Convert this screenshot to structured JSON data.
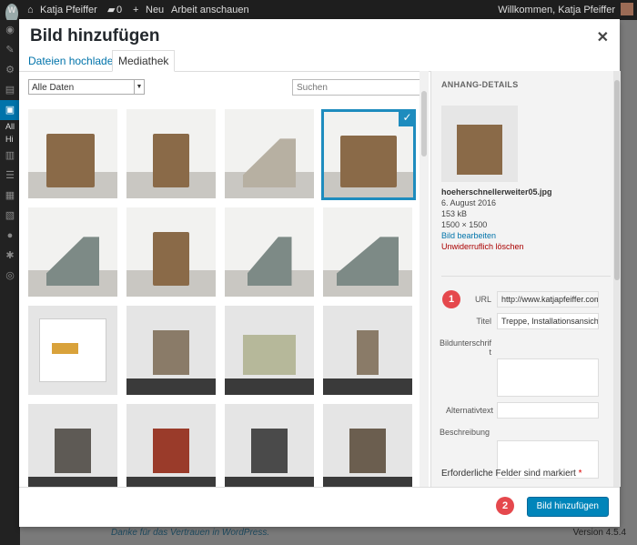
{
  "adminbar": {
    "site_name": "Katja Pfeiffer",
    "comments_count": "0",
    "new_label": "Neu",
    "view_label": "Arbeit anschauen",
    "greeting": "Willkommen, Katja Pfeiffer"
  },
  "sidebar": {
    "labels": [
      "All",
      "Hi"
    ]
  },
  "footer": {
    "thanks": "Danke für das Vertrauen in WordPress.",
    "version": "Version 4.5.4"
  },
  "modal": {
    "title": "Bild hinzufügen",
    "tabs": [
      {
        "label": "Dateien hochladen"
      },
      {
        "label": "Mediathek"
      }
    ],
    "filter_value": "Alle Daten",
    "search_placeholder": "Suchen",
    "details": {
      "heading": "ANHANG-DETAILS",
      "filename": "hoeherschnellerweiter05.jpg",
      "date": "6. August 2016",
      "size": "153 kB",
      "dimensions": "1500 × 1500",
      "edit_link": "Bild bearbeiten",
      "delete_link": "Unwiderruflich löschen",
      "url_label": "URL",
      "url_value": "http://www.katjapfeiffer.com",
      "title_label": "Titel",
      "title_value": "Treppe, Installationsansicht",
      "caption_label": "Bildunterschrift",
      "alt_label": "Alternativtext",
      "description_label": "Beschreibung",
      "required_note": "Erforderliche Felder sind markiert",
      "required_star": "*"
    },
    "insert_label": "Bild hinzufügen"
  },
  "badges": [
    "1",
    "2"
  ],
  "icons": {
    "check": "check-icon",
    "close": "close-icon"
  },
  "colors": {
    "accent": "#0085ba",
    "selected_border": "#1e8cbe",
    "badge": "#e5484d"
  }
}
